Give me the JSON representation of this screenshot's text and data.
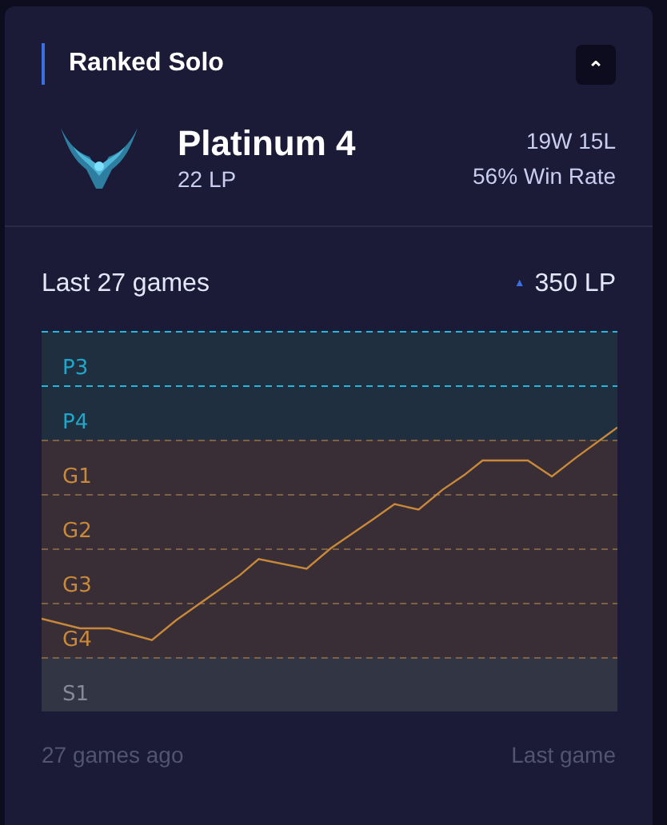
{
  "header": {
    "title": "Ranked Solo",
    "collapse_symbol": "⌃"
  },
  "rank": {
    "tier": "Platinum 4",
    "lp": "22 LP",
    "record": "19W 15L",
    "win_rate": "56% Win Rate"
  },
  "history": {
    "title": "Last 27 games",
    "change_symbol": "▲",
    "change": "350 LP",
    "start_label": "27 games ago",
    "end_label": "Last game",
    "bands": [
      {
        "label": "P3",
        "kind": "platinum",
        "color": "#1fa6c9"
      },
      {
        "label": "P4",
        "kind": "platinum",
        "color": "#1fa6c9"
      },
      {
        "label": "G1",
        "kind": "gold",
        "color": "#c8893a"
      },
      {
        "label": "G2",
        "kind": "gold",
        "color": "#c8893a"
      },
      {
        "label": "G3",
        "kind": "gold",
        "color": "#c8893a"
      },
      {
        "label": "G4",
        "kind": "gold",
        "color": "#c8893a"
      },
      {
        "label": "S1",
        "kind": "silver",
        "color": "#858b96"
      }
    ]
  }
}
